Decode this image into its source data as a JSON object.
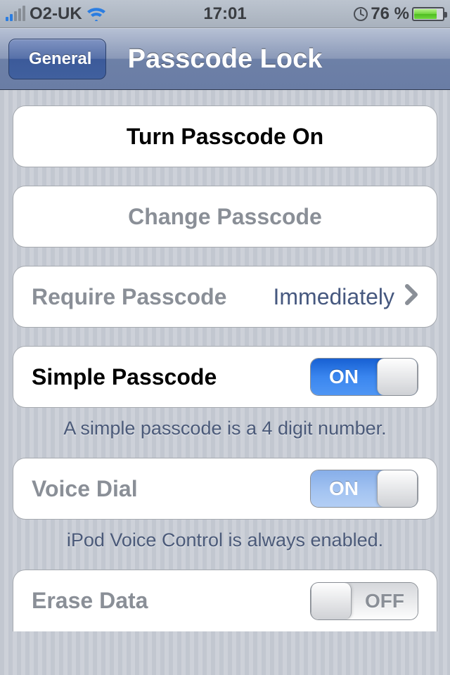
{
  "status": {
    "carrier": "O2-UK",
    "time": "17:01",
    "battery_percent": "76 %"
  },
  "nav": {
    "back_label": "General",
    "title": "Passcode Lock"
  },
  "cells": {
    "turn_on": "Turn Passcode On",
    "change": "Change Passcode",
    "require_label": "Require Passcode",
    "require_value": "Immediately",
    "simple_label": "Simple Passcode",
    "simple_footer": "A simple passcode is a 4 digit number.",
    "voice_label": "Voice Dial",
    "voice_footer": "iPod Voice Control is always enabled.",
    "erase_label": "Erase Data"
  },
  "switch": {
    "on": "ON",
    "off": "OFF"
  }
}
